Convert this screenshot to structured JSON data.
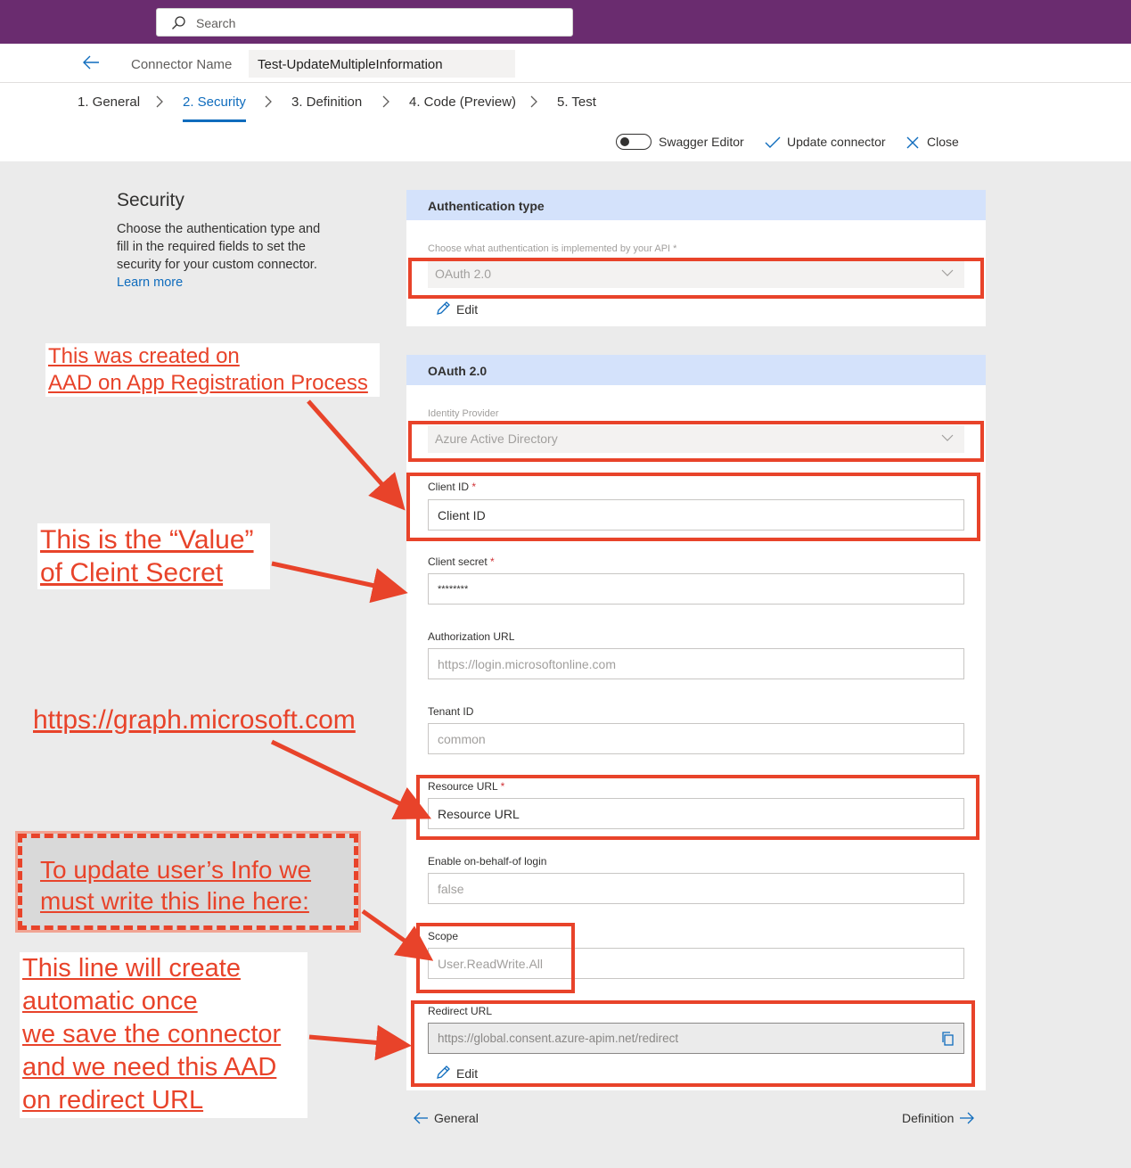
{
  "search": {
    "placeholder": "Search"
  },
  "header": {
    "connector_label": "Connector Name",
    "connector_name": "Test-UpdateMultipleInformation"
  },
  "tabs": [
    {
      "label": "1. General"
    },
    {
      "label": "2. Security"
    },
    {
      "label": "3. Definition"
    },
    {
      "label": "4. Code (Preview)"
    },
    {
      "label": "5. Test"
    }
  ],
  "toolbar": {
    "swagger": "Swagger Editor",
    "update": "Update connector",
    "close": "Close"
  },
  "security": {
    "title": "Security",
    "description": "Choose the authentication type and fill in the required fields to set the security for your custom connector.",
    "learn_more": "Learn more"
  },
  "auth_panel": {
    "title": "Authentication type",
    "label": "Choose what authentication is implemented by your API",
    "required": "*",
    "value": "OAuth 2.0",
    "edit": "Edit"
  },
  "oauth_panel": {
    "title": "OAuth 2.0",
    "identity_provider": {
      "label": "Identity Provider",
      "value": "Azure Active Directory"
    },
    "client_id": {
      "label": "Client ID",
      "required": "*",
      "value": "Client ID"
    },
    "client_secret": {
      "label": "Client secret",
      "required": "*",
      "value": "********"
    },
    "authorization_url": {
      "label": "Authorization URL",
      "placeholder": "https://login.microsoftonline.com"
    },
    "tenant_id": {
      "label": "Tenant ID",
      "placeholder": "common"
    },
    "resource_url": {
      "label": "Resource URL",
      "required": "*",
      "value": "Resource URL"
    },
    "obo": {
      "label": "Enable on-behalf-of login",
      "placeholder": "false"
    },
    "scope": {
      "label": "Scope",
      "placeholder": "User.ReadWrite.All"
    },
    "redirect_url": {
      "label": "Redirect URL",
      "value": "https://global.consent.azure-apim.net/redirect"
    },
    "edit": "Edit"
  },
  "footer": {
    "prev": "General",
    "next": "Definition"
  },
  "annotations": {
    "aad_note_line1": "This was created on",
    "aad_note_line2": "AAD on App Registration Process",
    "secret_note_line1": "This is  the “Value”",
    "secret_note_line2": "of Cleint Secret",
    "graph_note": "https://graph.microsoft.com",
    "scope_note_line1": "To  update  user’s  Info  we",
    "scope_note_line2": "must write this line here:",
    "redirect_note_line1": "This   line will create",
    "redirect_note_line2": "automatic once",
    "redirect_note_line3": "we save the  connector",
    "redirect_note_line4": "and we need this AAD",
    "redirect_note_line5": "on redirect URL"
  },
  "colors": {
    "brand": "#6a2c6f",
    "accent": "#0f6cbd",
    "annotation": "#e8432a",
    "panel_header": "#d4e2fb"
  }
}
